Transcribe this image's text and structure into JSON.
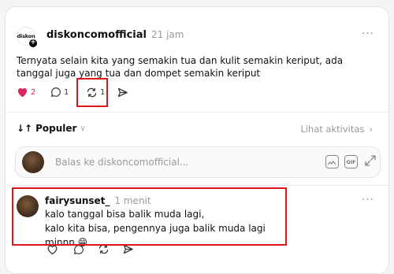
{
  "post": {
    "username": "diskoncomofficial",
    "time": "21 jam",
    "more": "···",
    "logo_text": "diskon",
    "text": "Ternyata selain kita yang semakin tua dan kulit semakin keriput, ada tanggal juga yang tua dan dompet semakin keriput",
    "likes": "2",
    "comments": "1",
    "reposts": "1",
    "liked_color": "#e0245e"
  },
  "sort": {
    "label": "Populer",
    "arrows": "↓↑"
  },
  "activity": {
    "label": "Lihat aktivitas",
    "chevron": "›"
  },
  "reply": {
    "placeholder": "Balas ke diskoncomofficial...",
    "gif_label": "GIF"
  },
  "comment": {
    "username": "fairysunset_",
    "time": "1 menit",
    "more": "···",
    "line1": "kalo tanggal bisa balik muda lagi,",
    "line2": "kalo kita bisa, pengennya juga balik muda lagi minnn 😁"
  },
  "colors": {
    "highlight_box": "#e0161b",
    "muted": "#999999"
  }
}
